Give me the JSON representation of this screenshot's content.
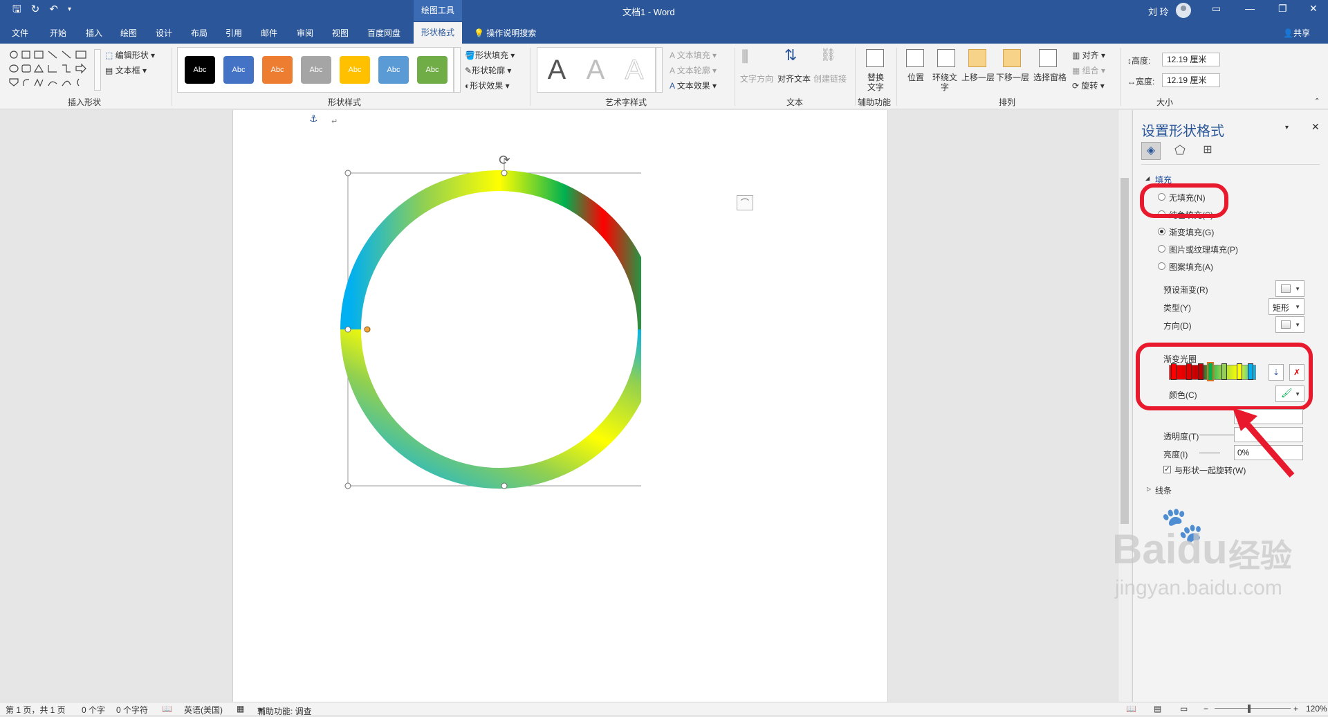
{
  "title_bar": {
    "contextual_group": "绘图工具",
    "document_title": "文档1 - Word",
    "user_name": "刘 玲",
    "accent": "#2b579a"
  },
  "tabs": [
    "文件",
    "开始",
    "插入",
    "绘图",
    "设计",
    "布局",
    "引用",
    "邮件",
    "审阅",
    "视图",
    "百度网盘"
  ],
  "active_tab": "形状格式",
  "tell_me": "操作说明搜索",
  "share": "共享",
  "ribbon": {
    "insert_shapes": {
      "label": "插入形状",
      "edit_shape": "编辑形状",
      "text_box": "文本框"
    },
    "shape_styles": {
      "label": "形状样式",
      "preset_label": "Abc",
      "preset_colors": [
        "#000000",
        "#4472c4",
        "#ed7d31",
        "#a5a5a5",
        "#ffc000",
        "#5b9bd5",
        "#70ad47"
      ],
      "fill": "形状填充",
      "outline": "形状轮廓",
      "effects": "形状效果"
    },
    "wordart": {
      "label": "艺术字样式",
      "glyph": "A",
      "text_fill": "文本填充",
      "text_outline": "文本轮廓",
      "text_effects": "文本效果"
    },
    "text": {
      "label": "文本",
      "direction": "文字方向",
      "align": "对齐文本",
      "link": "创建链接"
    },
    "accessibility": {
      "label": "辅助功能",
      "alt_text_line1": "替换",
      "alt_text_line2": "文字"
    },
    "arrange": {
      "label": "排列",
      "position": "位置",
      "wrap_line1": "环绕文",
      "wrap_line2": "字",
      "bring_forward": "上移一层",
      "send_backward": "下移一层",
      "selection_pane": "选择窗格",
      "align": "对齐",
      "group": "组合",
      "rotate": "旋转"
    },
    "size": {
      "label": "大小",
      "height_label": "高度:",
      "height_value": "12.19 厘米",
      "width_label": "宽度:",
      "width_value": "12.19 厘米"
    }
  },
  "format_pane": {
    "title": "设置形状格式",
    "section_fill": "填充",
    "no_fill": "无填充(N)",
    "solid_fill": "纯色填充(S)",
    "gradient_fill": "渐变填充(G)",
    "picture_fill": "图片或纹理填充(P)",
    "pattern_fill": "图案填充(A)",
    "preset_gradient": "预设渐变(R)",
    "type_label": "类型(Y)",
    "type_value": "矩形",
    "direction_label": "方向(D)",
    "gradient_stops_label": "渐变光圈",
    "gradient_stop_colors": [
      "#ff0000",
      "#e00000",
      "#c00000",
      "#00b050",
      "#92d050",
      "#ffff00",
      "#00b0f0"
    ],
    "color_label": "颜色(C)",
    "transparency_label": "透明度(T)",
    "brightness_label": "亮度(I)",
    "brightness_value": "0%",
    "rotate_with_shape": "与形状一起旋转(W)",
    "section_line": "线条"
  },
  "status_bar": {
    "page": "第 1 页，共 1 页",
    "words": "0 个字",
    "chars": "0 个字符",
    "language": "英语(美国)",
    "accessibility": "辅助功能: 调查",
    "zoom": "120%"
  },
  "watermark": {
    "brand": "Bai",
    "brand2": "du",
    "cn": "经验",
    "url": "jingyan.baidu.com"
  }
}
